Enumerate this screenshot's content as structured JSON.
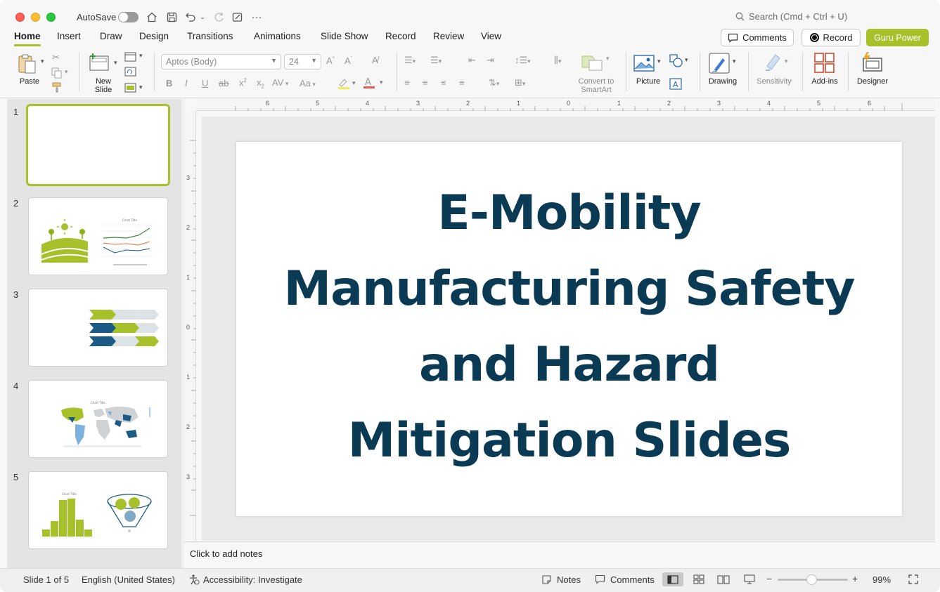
{
  "titlebar": {
    "autosave_label": "AutoSave",
    "search_placeholder": "Search (Cmd + Ctrl + U)"
  },
  "tabs": [
    {
      "label": "Home",
      "active": true
    },
    {
      "label": "Insert"
    },
    {
      "label": "Draw"
    },
    {
      "label": "Design"
    },
    {
      "label": "Transitions"
    },
    {
      "label": "Animations"
    },
    {
      "label": "Slide Show"
    },
    {
      "label": "Record"
    },
    {
      "label": "Review"
    },
    {
      "label": "View"
    }
  ],
  "actions": {
    "comments": "Comments",
    "record": "Record",
    "guru": "Guru Power"
  },
  "ribbon": {
    "paste": "Paste",
    "new_slide_1": "New",
    "new_slide_2": "Slide",
    "font_name": "Aptos (Body)",
    "font_size": "24",
    "convert_1": "Convert to",
    "convert_2": "SmartArt",
    "picture": "Picture",
    "drawing": "Drawing",
    "sensitivity": "Sensitivity",
    "addins": "Add-ins",
    "designer": "Designer"
  },
  "thumbnails": [
    {
      "num": "1",
      "selected": true
    },
    {
      "num": "2"
    },
    {
      "num": "3"
    },
    {
      "num": "4"
    },
    {
      "num": "5"
    }
  ],
  "ruler": {
    "h_ticks": [
      "6",
      "5",
      "4",
      "3",
      "2",
      "1",
      "0",
      "1",
      "2",
      "3",
      "4",
      "5",
      "6"
    ],
    "v_ticks": [
      "3",
      "2",
      "1",
      "0",
      "1",
      "2",
      "3"
    ]
  },
  "slide": {
    "title_lines": [
      "E-Mobility",
      "Manufacturing Safety",
      "and Hazard",
      "Mitigation Slides"
    ]
  },
  "notes": {
    "placeholder": "Click to add notes"
  },
  "status": {
    "slide_counter": "Slide 1 of 5",
    "language": "English (United States)",
    "accessibility": "Accessibility: Investigate",
    "notes": "Notes",
    "comments": "Comments",
    "zoom": "99%"
  },
  "colors": {
    "accent": "#a7c12b",
    "title": "#0b3a55",
    "navy": "#1c5b85"
  }
}
